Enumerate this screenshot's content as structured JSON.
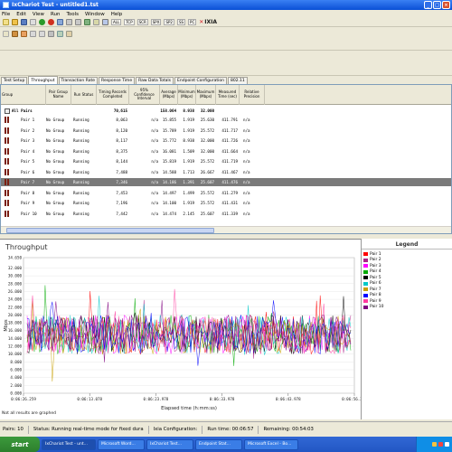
{
  "window": {
    "title": "IxChariot Test - untitled1.tst"
  },
  "menu": [
    "File",
    "Edit",
    "View",
    "Run",
    "Tools",
    "Window",
    "Help"
  ],
  "toolbar": {
    "protocols": [
      "ALL",
      "TCP",
      "SCR",
      "SPX",
      "SP2",
      "SS",
      "PC"
    ],
    "brand": "IXIA"
  },
  "tabs": [
    "Test Setup",
    "Throughput",
    "Transaction Rate",
    "Response Time",
    "Raw Data Totals",
    "Endpoint Configuration",
    "802.11"
  ],
  "active_tab": "Throughput",
  "grid": {
    "columns": [
      "Group",
      "Pair Group Name",
      "Run Status",
      "Timing Records Completed",
      "95% Confidence Interval",
      "Average (Mbps)",
      "Minimum (Mbps)",
      "Maximum (Mbps)",
      "Measured Time (sec)",
      "Relative Precision"
    ],
    "all_pairs": {
      "label": "All Pairs",
      "records": "70,615",
      "average": "158.064",
      "minimum": "8.938",
      "maximum": "32.000"
    },
    "rows": [
      {
        "pair": "Pair 1",
        "group": "No Group",
        "status": "Running",
        "records": "8,063",
        "ci": "n/a",
        "avg": "15.855",
        "min": "1.919",
        "max": "25.630",
        "time": "411.791",
        "prec": "n/a"
      },
      {
        "pair": "Pair 2",
        "group": "No Group",
        "status": "Running",
        "records": "8,120",
        "ci": "n/a",
        "avg": "15.789",
        "min": "1.919",
        "max": "25.572",
        "time": "411.717",
        "prec": "n/a"
      },
      {
        "pair": "Pair 3",
        "group": "No Group",
        "status": "Running",
        "records": "8,117",
        "ci": "n/a",
        "avg": "15.772",
        "min": "8.938",
        "max": "32.000",
        "time": "411.726",
        "prec": "n/a"
      },
      {
        "pair": "Pair 4",
        "group": "No Group",
        "status": "Running",
        "records": "8,375",
        "ci": "n/a",
        "avg": "16.081",
        "min": "1.509",
        "max": "32.000",
        "time": "411.664",
        "prec": "n/a"
      },
      {
        "pair": "Pair 5",
        "group": "No Group",
        "status": "Running",
        "records": "8,144",
        "ci": "n/a",
        "avg": "15.819",
        "min": "1.919",
        "max": "25.572",
        "time": "411.719",
        "prec": "n/a"
      },
      {
        "pair": "Pair 6",
        "group": "No Group",
        "status": "Running",
        "records": "7,488",
        "ci": "n/a",
        "avg": "14.588",
        "min": "1.713",
        "max": "26.667",
        "time": "411.467",
        "prec": "n/a"
      },
      {
        "pair": "Pair 7",
        "group": "No Group",
        "status": "Running",
        "records": "7,346",
        "ci": "n/a",
        "avg": "14.186",
        "min": "1.391",
        "max": "25.607",
        "time": "411.476",
        "prec": "n/a"
      },
      {
        "pair": "Pair 8",
        "group": "No Group",
        "status": "Running",
        "records": "7,453",
        "ci": "n/a",
        "avg": "14.497",
        "min": "1.499",
        "max": "25.572",
        "time": "411.279",
        "prec": "n/a"
      },
      {
        "pair": "Pair 9",
        "group": "No Group",
        "status": "Running",
        "records": "7,196",
        "ci": "n/a",
        "avg": "14.100",
        "min": "1.919",
        "max": "25.572",
        "time": "411.431",
        "prec": "n/a"
      },
      {
        "pair": "Pair 10",
        "group": "No Group",
        "status": "Running",
        "records": "7,442",
        "ci": "n/a",
        "avg": "14.474",
        "min": "2.145",
        "max": "25.607",
        "time": "411.339",
        "prec": "n/a"
      }
    ]
  },
  "chart_data": {
    "type": "line",
    "title": "Throughput",
    "ylabel": "Mbps",
    "xlabel": "Elapsed time (h:mm:ss)",
    "ylim": [
      0,
      34.65
    ],
    "yticks": [
      "34.650",
      "32.000",
      "30.000",
      "28.000",
      "26.000",
      "24.000",
      "22.000",
      "20.000",
      "18.000",
      "16.000",
      "14.000",
      "12.000",
      "10.000",
      "8.000",
      "6.000",
      "4.000",
      "2.000",
      "0.000"
    ],
    "xticks": [
      "0:06:26.259",
      "0:06:13.078",
      "0:06:23.978",
      "0:06:33.978",
      "0:06:43.978",
      "0:06:56.259"
    ],
    "series_names": [
      "Pair 1",
      "Pair 2",
      "Pair 3",
      "Pair 4",
      "Pair 5",
      "Pair 6",
      "Pair 7",
      "Pair 8",
      "Pair 9",
      "Pair 10"
    ],
    "series_colors": [
      "#ff0000",
      "#aa2288",
      "#ff00ff",
      "#00aa00",
      "#000000",
      "#00c8c8",
      "#c8a000",
      "#0000ff",
      "#ff3ca0",
      "#800080"
    ],
    "approx_level": 15,
    "approx_spread": 5
  },
  "chart_note": "Not all results are graphed",
  "legend": {
    "title": "Legend"
  },
  "status": {
    "pairs": "Pairs: 10",
    "status": "Status: Running real-time mode for fixed dura",
    "ixia_config": "Ixia Configuration:",
    "run_time": "Run time: 00:06:57",
    "remaining": "Remaining: 00:54:03"
  },
  "taskbar": {
    "start": "start",
    "tasks": [
      "IxChariot Test - unt...",
      "Microsoft Word...",
      "IxChariot Test...",
      "Endpoint Stat...",
      "Microsoft Excel - Bo..."
    ]
  }
}
